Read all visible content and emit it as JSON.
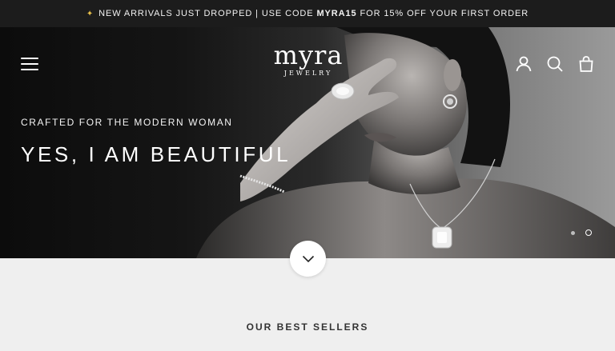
{
  "announcement": {
    "spark": "✦",
    "text_before": "NEW ARRIVALS JUST DROPPED | USE CODE",
    "code": "MYRA15",
    "text_after": "FOR 15% OFF YOUR FIRST ORDER"
  },
  "header": {
    "logo_word": "myra",
    "logo_sub": "JEWELRY",
    "icons": [
      "menu-icon",
      "account-icon",
      "search-icon",
      "bag-icon"
    ]
  },
  "hero": {
    "eyebrow": "CRAFTED FOR THE MODERN WOMAN",
    "headline": "YES, I AM BEAUTIFUL",
    "slides_count": 2,
    "active_slide": 2
  },
  "colors": {
    "announcement_bg": "#1c1c1c",
    "accent_spark": "#e8c04a",
    "page_bg": "#efefef"
  },
  "best_sellers": {
    "title": "OUR BEST SELLERS"
  }
}
